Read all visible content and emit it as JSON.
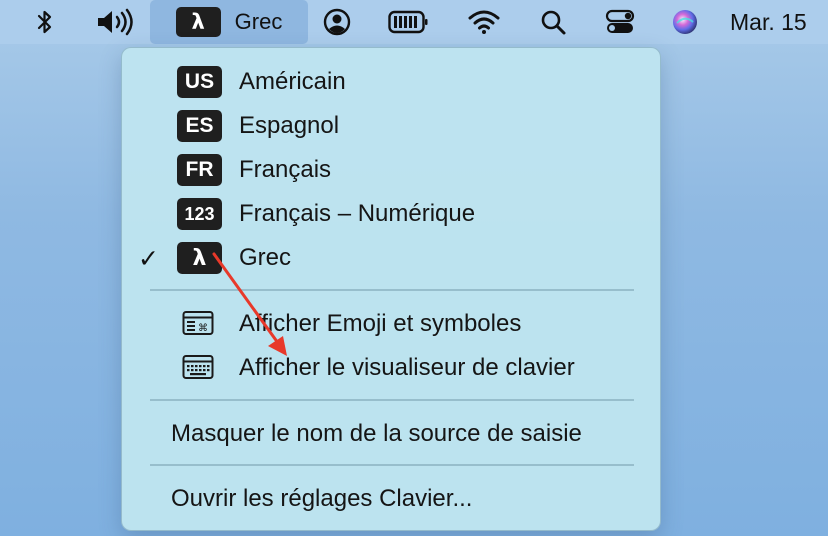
{
  "menubar": {
    "input_source": {
      "badge": "λ",
      "label": "Grec"
    },
    "date": "Mar. 15",
    "icons": [
      "bluetooth-icon",
      "volume-icon",
      "user-icon",
      "battery-icon",
      "wifi-icon",
      "search-icon",
      "control-center-icon",
      "siri-icon"
    ]
  },
  "menu": {
    "sources": [
      {
        "badge": "US",
        "label": "Américain",
        "checked": false
      },
      {
        "badge": "ES",
        "label": "Espagnol",
        "checked": false
      },
      {
        "badge": "FR",
        "label": "Français",
        "checked": false
      },
      {
        "badge": "123",
        "label": "Français – Numérique",
        "checked": false
      },
      {
        "badge": "λ",
        "label": "Grec",
        "checked": true
      }
    ],
    "check_mark": "✓",
    "show_emoji": "Afficher Emoji et symboles",
    "show_keyboard_viewer": "Afficher le visualiseur de clavier",
    "hide_source_name": "Masquer le nom de la source de saisie",
    "open_keyboard_settings": "Ouvrir les réglages Clavier..."
  },
  "colors": {
    "annotation_arrow": "#e8392a",
    "badge_bg": "#1f1f1f"
  }
}
